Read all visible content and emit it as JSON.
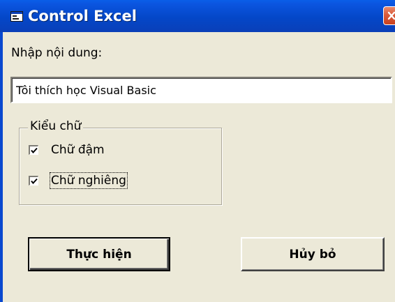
{
  "window": {
    "title": "Control Excel",
    "icon": "vb-form-icon"
  },
  "form": {
    "content_label": "Nhập nội dung:",
    "content_value": "Tôi thích học Visual Basic",
    "font_style_group": {
      "legend": "Kiểu chữ",
      "options": [
        {
          "label": "Chữ đậm",
          "checked": true
        },
        {
          "label": "Chữ nghiêng",
          "checked": true
        }
      ]
    },
    "buttons": {
      "execute_label": "Thực hiện",
      "cancel_label": "Hủy bỏ"
    }
  },
  "colors": {
    "titlebar": "#0447c8",
    "close_button": "#d95b3a",
    "dialog_background": "#ece9d8"
  }
}
